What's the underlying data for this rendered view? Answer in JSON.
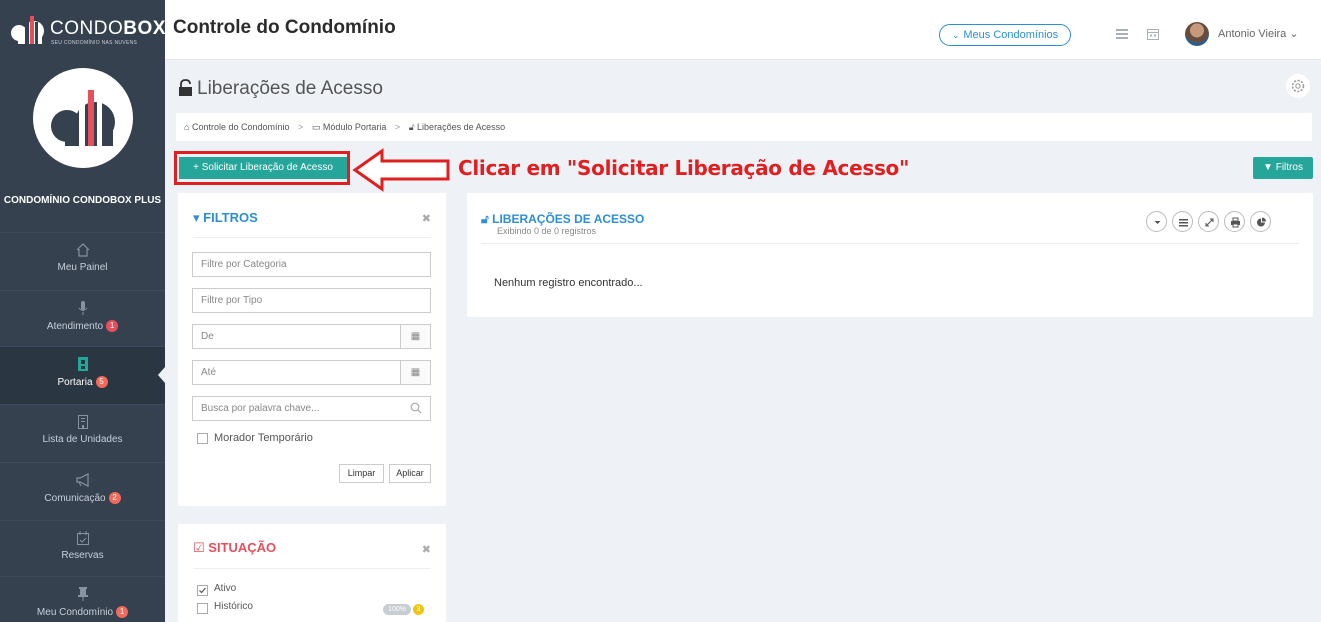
{
  "brand": {
    "logo_text_light": "CONDO",
    "logo_text_bold": "BOX",
    "logo_subtitle": "SEU CONDOMÍNIO NAS NUVENS"
  },
  "header": {
    "app_title": "Controle do Condomínio",
    "condominiums_button": "Meus Condomínios",
    "user_name": "Antonio Vieira"
  },
  "sidebar": {
    "condominium_name": "CONDOMÍNIO CONDOBOX PLUS",
    "items": [
      {
        "label": "Meu Painel",
        "icon": "home-icon",
        "badge": ""
      },
      {
        "label": "Atendimento",
        "icon": "microphone-icon",
        "badge": "1"
      },
      {
        "label": "Portaria",
        "icon": "doorman-icon",
        "badge": "5"
      },
      {
        "label": "Lista de Unidades",
        "icon": "building-icon",
        "badge": ""
      },
      {
        "label": "Comunicação",
        "icon": "megaphone-icon",
        "badge": "2"
      },
      {
        "label": "Reservas",
        "icon": "calendar-check-icon",
        "badge": ""
      },
      {
        "label": "Meu Condomínio",
        "icon": "pin-icon",
        "badge": "1"
      }
    ]
  },
  "page": {
    "title": "Liberações de Acesso",
    "breadcrumb": [
      "Controle do Condomínio",
      "Módulo Portaria",
      "Liberações de Acesso"
    ],
    "request_button": "+ Solicitar Liberação de Acesso",
    "filters_button": "Filtros",
    "annotation": "Clicar em \"Solicitar Liberação de Acesso\""
  },
  "filters": {
    "title": "FILTROS",
    "category_placeholder": "Filtre por Categoria",
    "type_placeholder": "Filtre por Tipo",
    "from_placeholder": "De",
    "to_placeholder": "Até",
    "keyword_placeholder": "Busca por palavra chave...",
    "temporary_resident_label": "Morador Temporário",
    "temporary_resident_checked": false,
    "clear_button": "Limpar",
    "apply_button": "Aplicar"
  },
  "situation": {
    "title": "SITUAÇÃO",
    "options": [
      {
        "label": "Ativo",
        "checked": true
      },
      {
        "label": "Histórico",
        "checked": false,
        "percent": "100%",
        "count": "3"
      }
    ]
  },
  "list": {
    "title": "LIBERAÇÕES DE ACESSO",
    "subtitle": "Exibindo 0 de 0 registros",
    "empty_message": "Nenhum registro encontrado..."
  },
  "colors": {
    "sidebar": "#364150",
    "accent_teal": "#26a69a",
    "accent_blue": "#2b8fd6",
    "annotation_red": "#e02020",
    "badge_red": "#e7505a"
  }
}
